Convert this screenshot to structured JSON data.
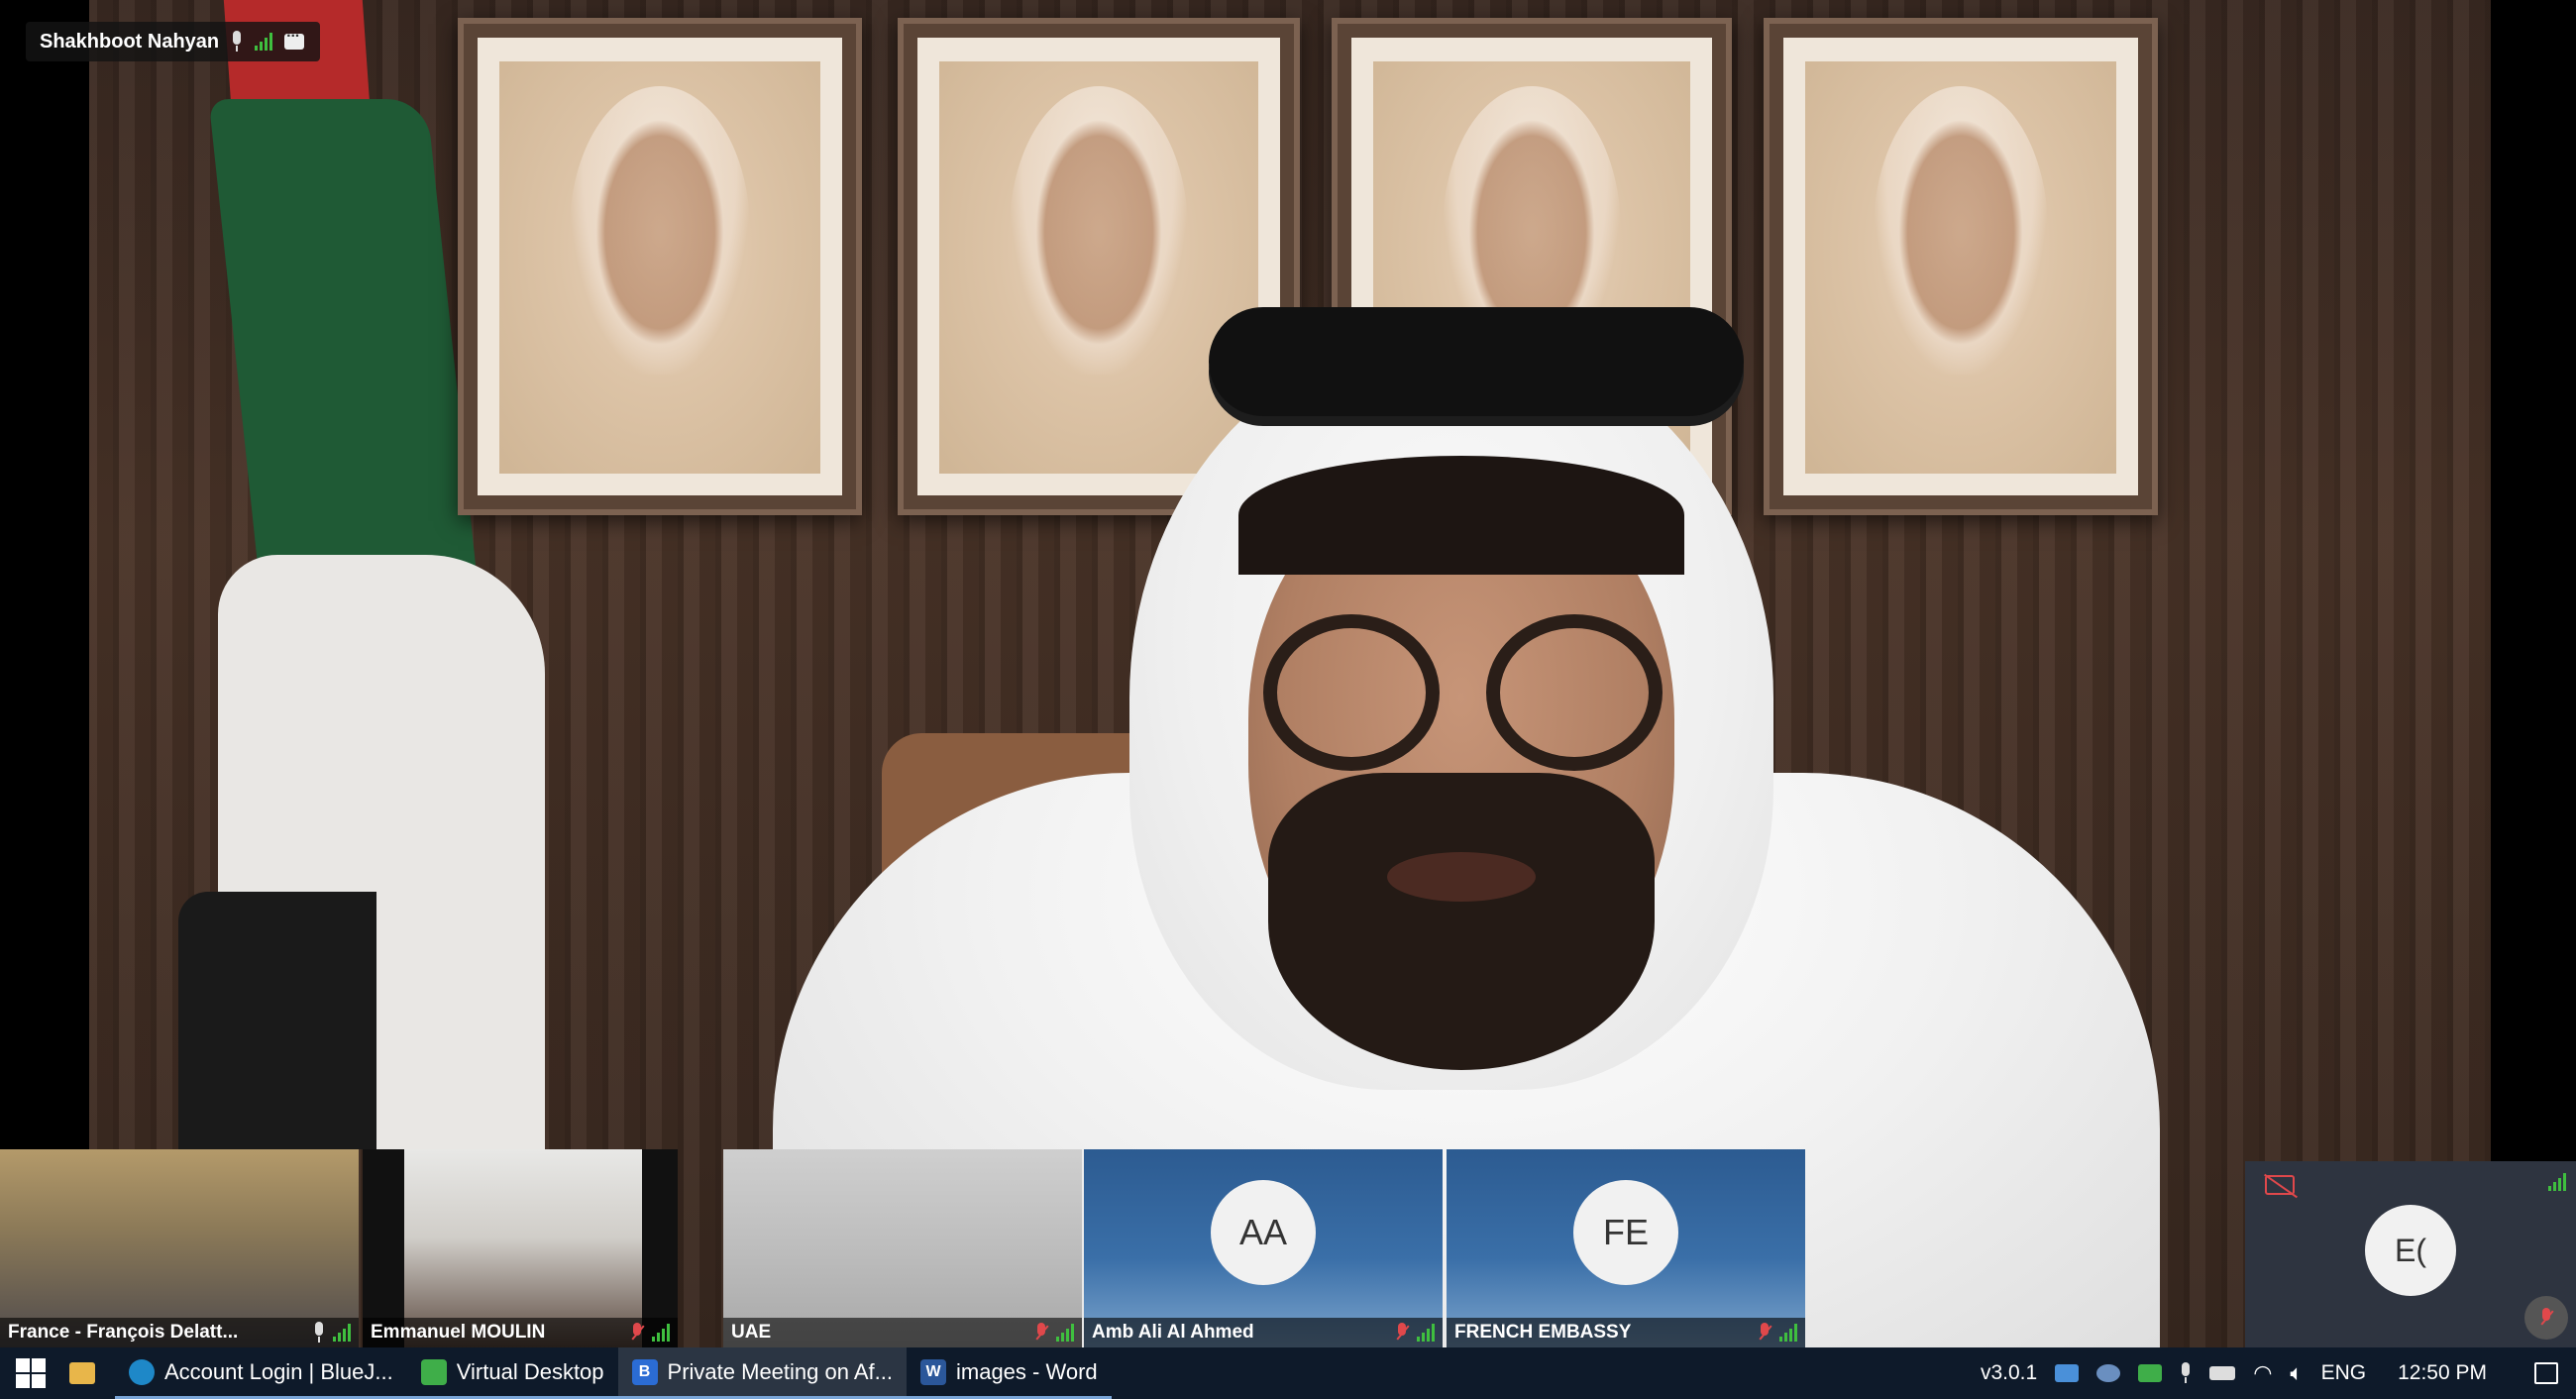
{
  "speaker": {
    "name": "Shakhboot Nahyan"
  },
  "thumbnails": [
    {
      "label": "France - François Delatt..."
    },
    {
      "label": "Emmanuel MOULIN"
    },
    {
      "label": "UAE"
    },
    {
      "label": "Amb Ali Al Ahmed",
      "initials": "AA"
    },
    {
      "label": "FRENCH EMBASSY",
      "initials": "FE"
    }
  ],
  "self_view": {
    "initials": "E("
  },
  "taskbar": {
    "apps": [
      {
        "label": "Account Login | BlueJ...",
        "icon": "edge-icon"
      },
      {
        "label": "Virtual Desktop",
        "icon": "virtual-desktop-icon"
      },
      {
        "label": "Private Meeting on Af...",
        "icon": "bluejeans-icon",
        "glyph": "B"
      },
      {
        "label": "images - Word",
        "icon": "word-icon",
        "glyph": "W"
      }
    ],
    "tray": {
      "version": "v3.0.1",
      "language": "ENG",
      "time": "12:50 PM"
    }
  },
  "colors": {
    "signal_green": "#3fbf3f",
    "muted_red": "#e0484b",
    "taskbar_bg": "#0e1a2a",
    "tile_blue": "#2c5b91"
  }
}
